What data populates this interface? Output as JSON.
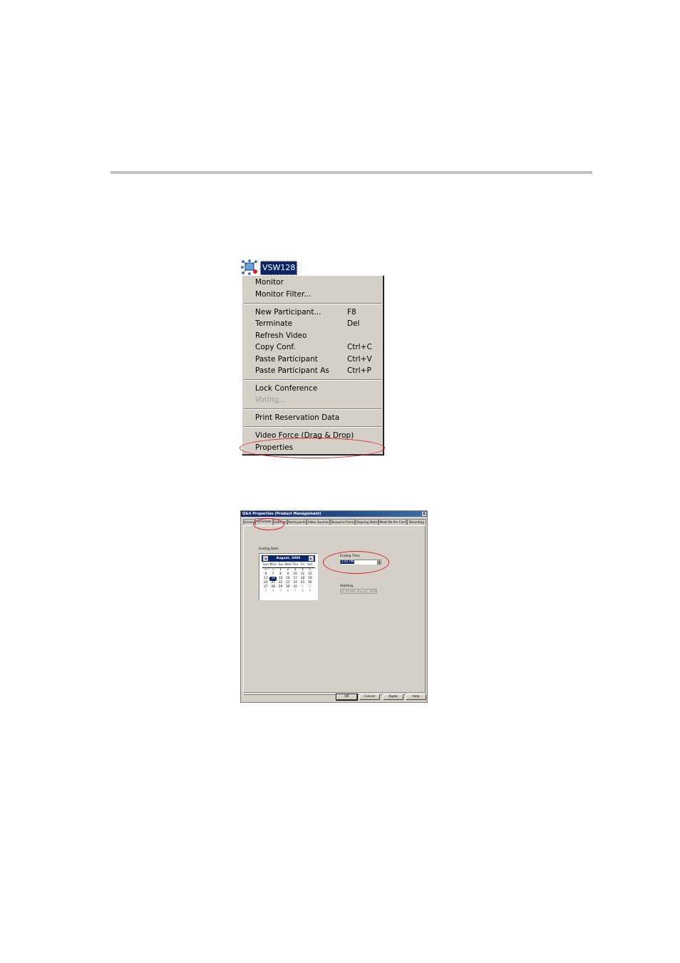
{
  "conference": {
    "name": "VSW128",
    "icon": "conference-icon"
  },
  "context_menu": {
    "items": [
      {
        "label": "Monitor",
        "shortcut": ""
      },
      {
        "label": "Monitor Filter...",
        "shortcut": ""
      },
      {
        "label": "New Participant...",
        "shortcut": "F8"
      },
      {
        "label": "Terminate",
        "shortcut": "Del"
      },
      {
        "label": "Refresh Video",
        "shortcut": ""
      },
      {
        "label": "Copy Conf.",
        "shortcut": "Ctrl+C"
      },
      {
        "label": "Paste Participant",
        "shortcut": "Ctrl+V"
      },
      {
        "label": "Paste Participant As",
        "shortcut": "Ctrl+P"
      },
      {
        "label": "Lock Conference",
        "shortcut": ""
      },
      {
        "label": "Voting...",
        "shortcut": "",
        "disabled": true
      },
      {
        "label": "Print Reservation Data",
        "shortcut": ""
      },
      {
        "label": "Video Force (Drag & Drop)",
        "shortcut": ""
      },
      {
        "label": "Properties",
        "shortcut": "",
        "highlighted": true
      }
    ]
  },
  "dialog": {
    "title": "Q&A Properties (Product Management)",
    "close": "x",
    "tabs": [
      "General",
      "Scheduler",
      "Settings",
      "Participants",
      "Video Sources",
      "Resource Force",
      "Ongoing State",
      "Meet Me Per Conf",
      "Recording"
    ],
    "active_tab": "Scheduler",
    "ending_date_label": "Ending Date",
    "calendar": {
      "month_label": "August, 2006",
      "prev": "◄",
      "next": "►",
      "weekdays": [
        "Sun",
        "Mon",
        "Tue",
        "Wed",
        "Thu",
        "Fri",
        "Sat"
      ],
      "weeks": [
        [
          "30",
          "31",
          "1",
          "2",
          "3",
          "4",
          "5"
        ],
        [
          "6",
          "7",
          "8",
          "9",
          "10",
          "11",
          "12"
        ],
        [
          "13",
          "14",
          "15",
          "16",
          "17",
          "18",
          "19"
        ],
        [
          "20",
          "21",
          "22",
          "23",
          "24",
          "25",
          "26"
        ],
        [
          "27",
          "28",
          "29",
          "30",
          "31",
          "1",
          "2"
        ],
        [
          "3",
          "4",
          "5",
          "6",
          "7",
          "8",
          "9"
        ]
      ],
      "selected_day": "14"
    },
    "ending_time_label": "Ending Time",
    "ending_time_value": "1:02 PM",
    "starting_label": "Starting",
    "starting_value": "10:33 AM, Aug 14, 2006",
    "buttons": [
      "OK",
      "Cancel",
      "Apply",
      "Help"
    ]
  }
}
